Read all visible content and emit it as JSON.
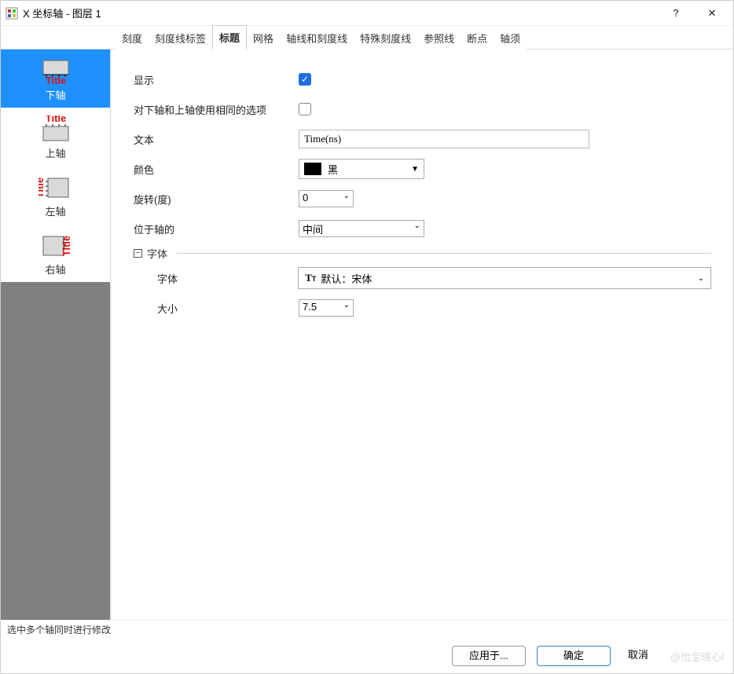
{
  "window": {
    "title": "X 坐标轴 - 图层 1"
  },
  "tabs": {
    "scale": "刻度",
    "tickLabels": "刻度线标签",
    "title": "标题",
    "grid": "网格",
    "axisTicks": "轴线和刻度线",
    "specialTicks": "特殊刻度线",
    "refLines": "参照线",
    "breaks": "断点",
    "rug": "轴须"
  },
  "sidebar": {
    "items": [
      {
        "label": "下轴"
      },
      {
        "label": "上轴"
      },
      {
        "label": "左轴"
      },
      {
        "label": "右轴"
      }
    ]
  },
  "form": {
    "show_label": "显示",
    "sameOptions_label": "对下轴和上轴使用相同的选项",
    "text_label": "文本",
    "text_value": "Time(ns)",
    "color_label": "颜色",
    "color_value": "黑",
    "color_hex": "#000000",
    "rotate_label": "旋转(度)",
    "rotate_value": "0",
    "position_label": "位于轴的",
    "position_value": "中间",
    "font_section": "字体",
    "font_label": "字体",
    "font_value": "默认：宋体",
    "size_label": "大小",
    "size_value": "7.5"
  },
  "footer": {
    "hint": "选中多个轴同时进行修改",
    "applyTo": "应用于...",
    "ok": "确定",
    "cancel": "取消",
    "watermark": "@怡宝晓心l"
  }
}
